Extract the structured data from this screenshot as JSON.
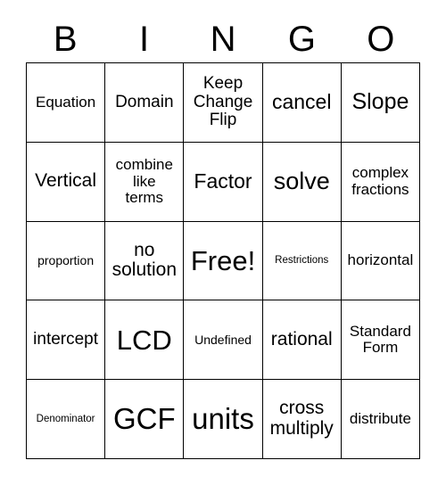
{
  "card": {
    "title": "BINGO",
    "header_letters": [
      "B",
      "I",
      "N",
      "G",
      "O"
    ],
    "free_space": "Free!",
    "colors": {
      "background": "#ffffff",
      "text": "#000000",
      "grid_line": "#000000"
    },
    "grid_size": "5x5",
    "rows": [
      [
        {
          "text": "Equation",
          "size": "md"
        },
        {
          "text": "Domain",
          "size": "lg"
        },
        {
          "text": "Keep\nChange\nFlip",
          "size": "lg"
        },
        {
          "text": "cancel",
          "size": "2xl"
        },
        {
          "text": "Slope",
          "size": "3xl"
        }
      ],
      [
        {
          "text": "Vertical",
          "size": "xl"
        },
        {
          "text": "combine\nlike\nterms",
          "size": "md"
        },
        {
          "text": "Factor",
          "size": "2xl"
        },
        {
          "text": "solve",
          "size": "4xl"
        },
        {
          "text": "complex\nfractions",
          "size": "md"
        }
      ],
      [
        {
          "text": "proportion",
          "size": "sm"
        },
        {
          "text": "no\nsolution",
          "size": "xl"
        },
        {
          "text": "Free!",
          "size": "5xl"
        },
        {
          "text": "Restrictions",
          "size": "xs"
        },
        {
          "text": "horizontal",
          "size": "md"
        }
      ],
      [
        {
          "text": "intercept",
          "size": "lg"
        },
        {
          "text": "LCD",
          "size": "5xl"
        },
        {
          "text": "Undefined",
          "size": "sm"
        },
        {
          "text": "rational",
          "size": "xl"
        },
        {
          "text": "Standard\nForm",
          "size": "md"
        }
      ],
      [
        {
          "text": "Denominator",
          "size": "xs"
        },
        {
          "text": "GCF",
          "size": "6xl"
        },
        {
          "text": "units",
          "size": "6xl"
        },
        {
          "text": "cross\nmultiply",
          "size": "xl"
        },
        {
          "text": "distribute",
          "size": "md"
        }
      ]
    ]
  }
}
